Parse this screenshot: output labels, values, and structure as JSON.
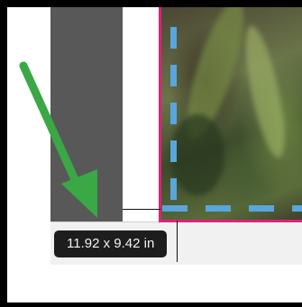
{
  "dimensions_readout": "11.92 x 9.42 in",
  "colors": {
    "frame_border": "#e0217a",
    "guide_line": "#58a6dc",
    "annotation_arrow": "#3aa845",
    "tooltip_bg": "#1d1d1d",
    "gray_strip": "#585858"
  },
  "icons": {
    "annotation_arrow": "arrow-down-right-icon"
  }
}
